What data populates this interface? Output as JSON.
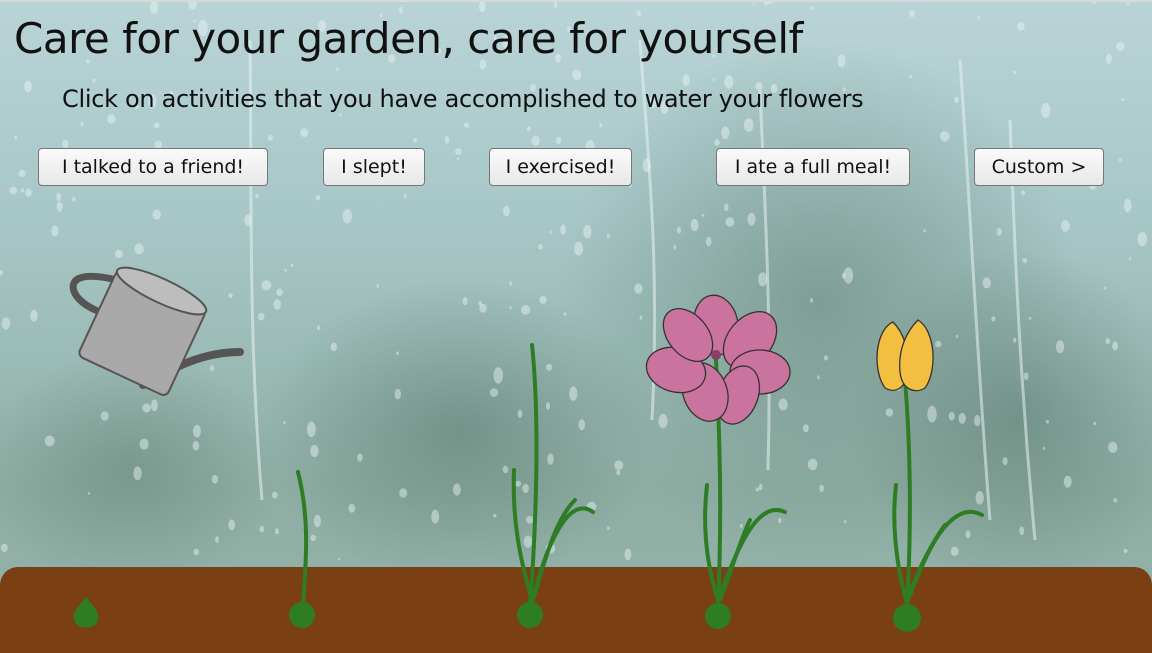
{
  "header": {
    "title": "Care for your garden, care for yourself",
    "subtitle": "Click on activities that you have accomplished to water your flowers"
  },
  "activities": [
    {
      "label": "I talked to a friend!"
    },
    {
      "label": "I slept!"
    },
    {
      "label": "I exercised!"
    },
    {
      "label": "I ate a full meal!"
    },
    {
      "label": "Custom >"
    }
  ],
  "garden": {
    "tool": "watering-can-icon",
    "plants": [
      {
        "stage": "seed"
      },
      {
        "stage": "sprout"
      },
      {
        "stage": "leaves"
      },
      {
        "stage": "pink-flower"
      },
      {
        "stage": "yellow-tulip"
      }
    ]
  },
  "colors": {
    "soil": "#7a3f12",
    "stem": "#2e7d24",
    "pink_petal": "#c9739e",
    "yellow_petal": "#f2bf40",
    "watering_can": "#a9a9a9"
  }
}
